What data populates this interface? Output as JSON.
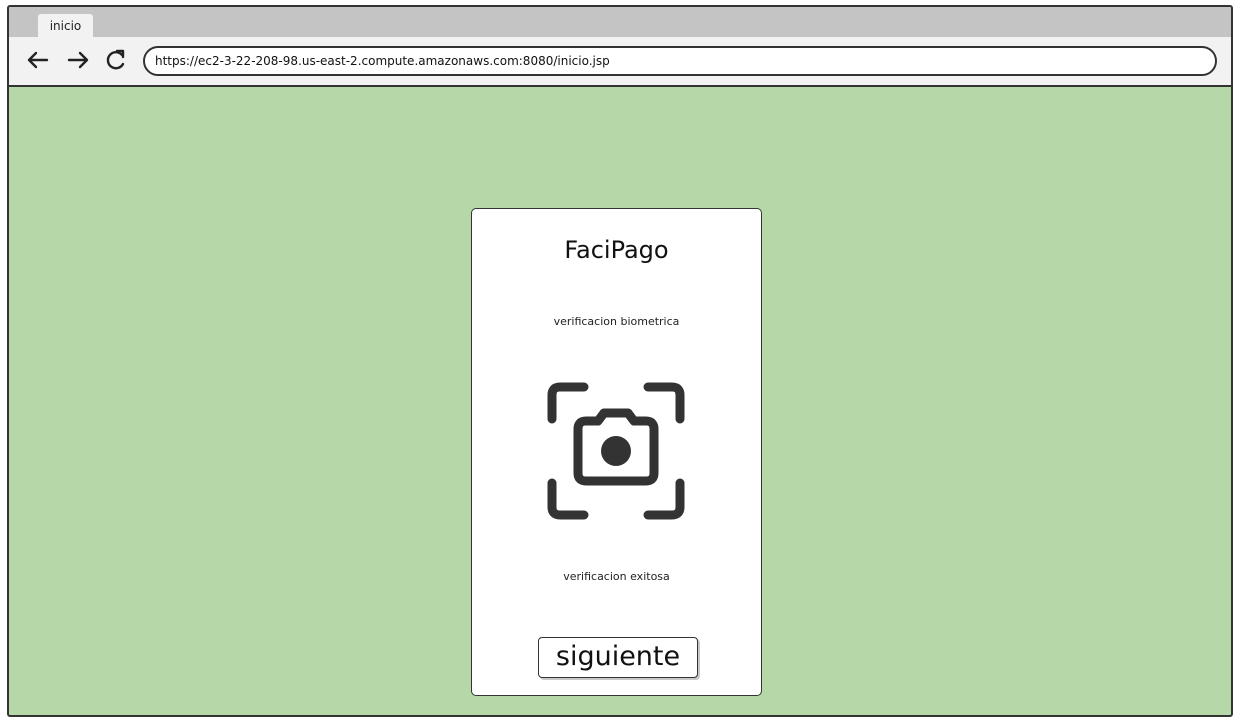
{
  "browser": {
    "tab_label": "inicio",
    "url": "https://ec2-3-22-208-98.us-east-2.compute.amazonaws.com:8080/inicio.jsp",
    "back_icon": "arrow-left-icon",
    "forward_icon": "arrow-right-icon",
    "reload_icon": "reload-icon"
  },
  "card": {
    "title": "FaciPago",
    "subtitle": "verificacion biometrica",
    "icon": "camera-scan-icon",
    "status": "verificacion exitosa",
    "next_label": "siguiente"
  },
  "colors": {
    "page_background": "#b6d7a8",
    "card_background": "#ffffff",
    "icon_color": "#333333"
  }
}
